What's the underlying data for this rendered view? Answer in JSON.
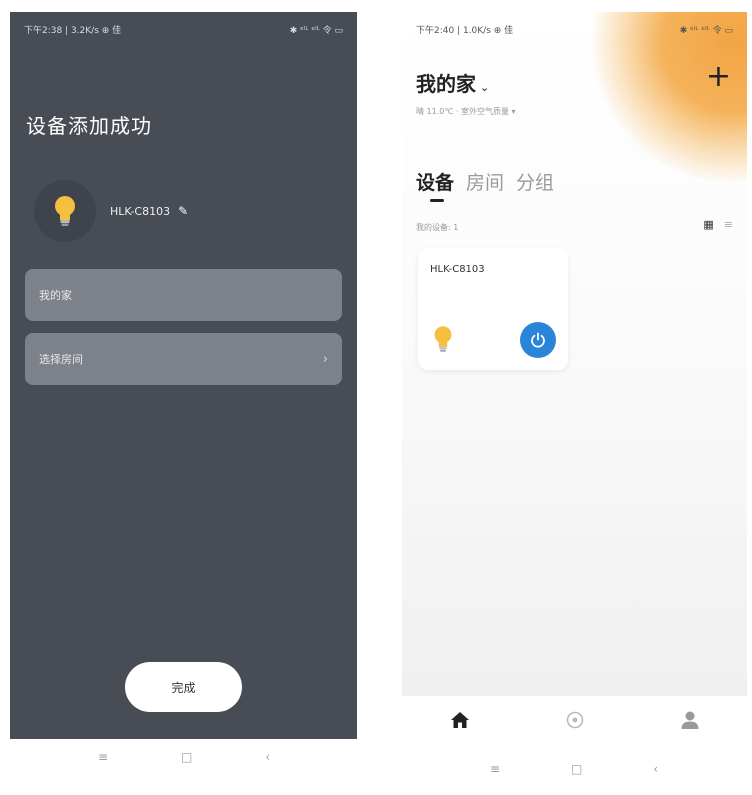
{
  "left_screen": {
    "status_bar": {
      "left": "下午2:38 | 3.2K/s ⊕ 佳",
      "right": "✱ ᵉˡᴸ ᵉˡᴸ 令 ▭"
    },
    "title": "设备添加成功",
    "device": {
      "name": "HLK-C8103",
      "edit_icon": "pencil-icon",
      "bulb_icon": "bulb-icon"
    },
    "fields": [
      {
        "label": "我的家"
      },
      {
        "label": "选择房间",
        "arrow": "›"
      }
    ],
    "done_button": "完成",
    "nav": {
      "menu": "≡",
      "home": "□",
      "back": "‹"
    }
  },
  "right_screen": {
    "status_bar": {
      "left": "下午2:40 | 1.0K/s ⊕ 佳",
      "right": "✱ ᵉˡᴸ ᵉˡᴸ 令 ▭"
    },
    "home_title": "我的家",
    "home_chevron": "⌄",
    "plus": "+",
    "weather": "晴 11.0℃ · 室外空气质量 ▾",
    "tabs": [
      {
        "label": "设备",
        "active": true
      },
      {
        "label": "房间",
        "active": false
      },
      {
        "label": "分组",
        "active": false
      }
    ],
    "device_count": "我的设备: 1",
    "view_icons": {
      "grid": "▦",
      "list": "≡"
    },
    "card": {
      "name": "HLK-C8103",
      "bulb_icon": "bulb-icon",
      "power_icon": "power-icon"
    },
    "tabbar": {
      "home": "home-icon",
      "scene": "scene-icon",
      "profile": "profile-icon"
    },
    "nav": {
      "menu": "≡",
      "home": "□",
      "back": "‹"
    }
  },
  "colors": {
    "left_bg": "#474c55",
    "field_bg": "#7d828a",
    "accent_blue": "#2a84d8",
    "bulb_yellow": "#f5c040",
    "sun_orange": "#f2a444"
  }
}
